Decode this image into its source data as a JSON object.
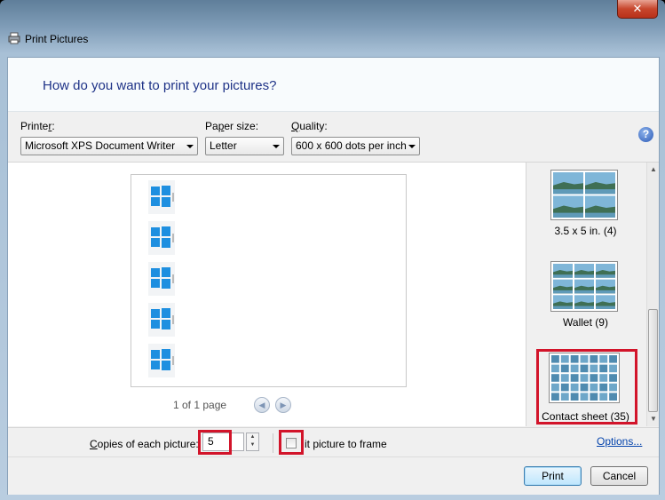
{
  "window": {
    "title": "Print Pictures",
    "close_glyph": "✕"
  },
  "header": {
    "title": "How do you want to print your pictures?"
  },
  "options": {
    "printer": {
      "label_pre": "Printe",
      "label_key": "r",
      "label_post": ":",
      "value": "Microsoft XPS Document Writer"
    },
    "paper_size": {
      "label_pre": "Pa",
      "label_key": "p",
      "label_post": "er size:",
      "value": "Letter"
    },
    "quality": {
      "label_pre": "",
      "label_key": "Q",
      "label_post": "uality:",
      "value": "600 x 600 dots per inch"
    },
    "help_glyph": "?"
  },
  "preview": {
    "page_count": "1 of 1 page",
    "prev_glyph": "◀",
    "next_glyph": "▶"
  },
  "layouts": [
    {
      "label": "3.5 x 5 in. (4)"
    },
    {
      "label": "Wallet (9)"
    },
    {
      "label": "Contact sheet (35)",
      "selected": true
    }
  ],
  "bottom": {
    "copies_label_key": "C",
    "copies_label_rest": "opies of each picture:",
    "copies_value": "5",
    "fit_label": "it picture to frame",
    "fit_checked": false,
    "options_link": "Options..."
  },
  "footer": {
    "print_label": "Print",
    "cancel_label": "Cancel"
  },
  "colors": {
    "accent": "#1e3287",
    "highlight": "#d2142a",
    "link": "#0645ad"
  }
}
